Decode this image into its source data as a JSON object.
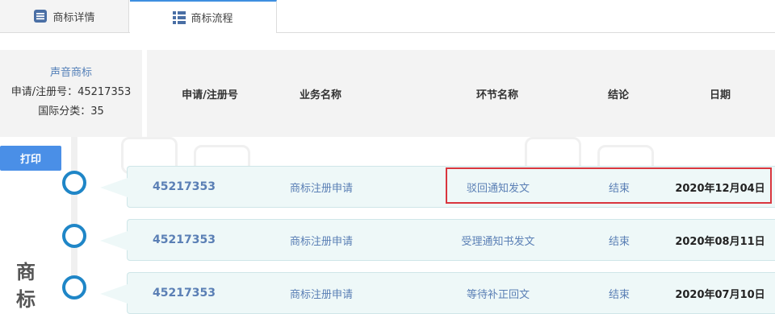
{
  "tabs": [
    {
      "label": "商标详情",
      "icon": "document-icon"
    },
    {
      "label": "商标流程",
      "icon": "list-icon"
    }
  ],
  "info": {
    "type": "声音商标",
    "reg_no": "申请/注册号：45217353",
    "intl_class": "国际分类：35"
  },
  "table": {
    "headers": [
      "申请/注册号",
      "业务名称",
      "环节名称",
      "结论",
      "日期"
    ],
    "rows": [
      {
        "reg_no": "45217353",
        "business": "商标注册申请",
        "step": "驳回通知发文",
        "result": "结束",
        "date": "2020年12月04日"
      },
      {
        "reg_no": "45217353",
        "business": "商标注册申请",
        "step": "受理通知书发文",
        "result": "结束",
        "date": "2020年08月11日"
      },
      {
        "reg_no": "45217353",
        "business": "商标注册申请",
        "step": "等待补正回文",
        "result": "结束",
        "date": "2020年07月10日"
      }
    ]
  },
  "print_label": "打印",
  "vertical_text": [
    "商",
    "标"
  ],
  "colors": {
    "accent": "#4a8fe7",
    "timeline_dot": "#1f86c7",
    "highlight": "#d9363e",
    "row_bg": "#eef8f8"
  }
}
